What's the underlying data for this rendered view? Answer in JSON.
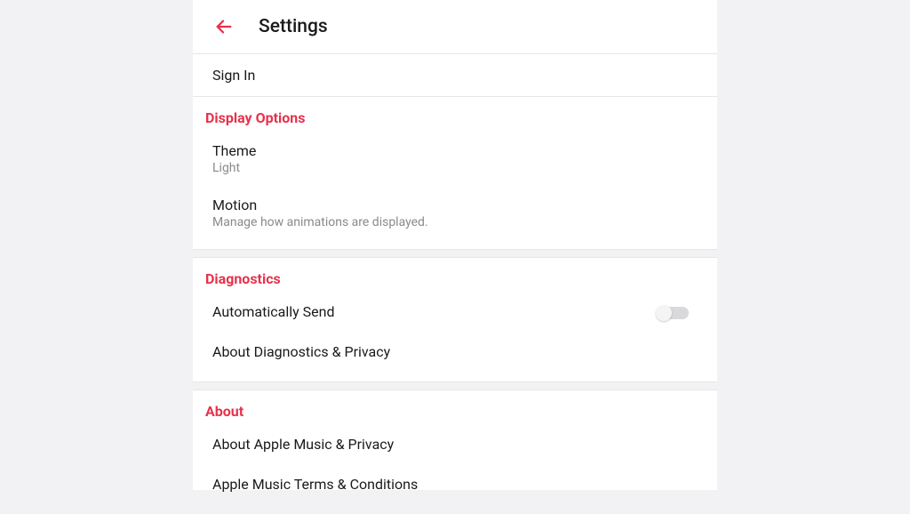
{
  "header": {
    "title": "Settings"
  },
  "rows": {
    "sign_in": "Sign In"
  },
  "sections": {
    "display": {
      "header": "Display Options",
      "items": {
        "theme": {
          "title": "Theme",
          "sub": "Light"
        },
        "motion": {
          "title": "Motion",
          "sub": "Manage how animations are displayed."
        }
      }
    },
    "diagnostics": {
      "header": "Diagnostics",
      "items": {
        "auto_send": {
          "title": "Automatically Send"
        },
        "about_diag": {
          "title": "About Diagnostics & Privacy"
        }
      }
    },
    "about": {
      "header": "About",
      "items": {
        "about_privacy": {
          "title": "About Apple Music & Privacy"
        },
        "terms": {
          "title": "Apple Music Terms & Conditions"
        }
      }
    }
  },
  "colors": {
    "accent": "#e8314b"
  }
}
